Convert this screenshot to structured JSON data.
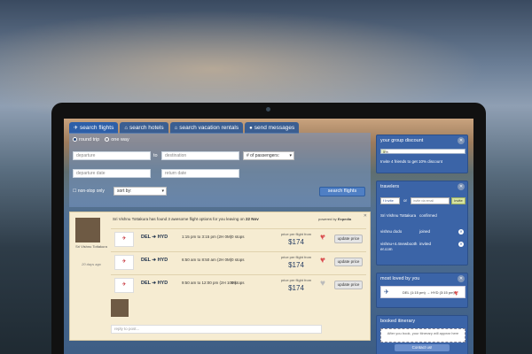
{
  "tabs": [
    {
      "label": "search flights",
      "icon": "plane-icon"
    },
    {
      "label": "search hotels",
      "icon": "home-icon"
    },
    {
      "label": "search vacation rentals",
      "icon": "home-icon"
    },
    {
      "label": "send messages",
      "icon": "chat-icon"
    }
  ],
  "search": {
    "round_trip": "round trip",
    "one_way": "one way",
    "departure_placeholder": "departure",
    "to_label": "to",
    "destination_placeholder": "destination",
    "passengers_label": "# of passengers:",
    "departure_date_placeholder": "departure date",
    "return_date_placeholder": "return date",
    "nonstop_label": "non-stop only",
    "sort_label": "sort by:",
    "search_button": "search flights"
  },
  "results": {
    "user_name": "Sri Vishnu Tottakura",
    "date_note": "20 days ago",
    "headline_prefix": "Sri Vishnu Tottakura has found 3 awesome flight options for you leaving on",
    "headline_date": "22 Nov",
    "powered_by": "powered by",
    "powered_brand": "Expedia",
    "price_label": "price per flight from",
    "update_label": "update price",
    "reply_placeholder": "reply to post...",
    "flights": [
      {
        "from": "DEL",
        "to": "HYD",
        "times": "1:15 pm to 3:15 pm (2H 0M)",
        "stops": "0 stops",
        "price": "$174",
        "likes": "2"
      },
      {
        "from": "DEL",
        "to": "HYD",
        "times": "6:50 am to 8:50 am (2H 0M)",
        "stops": "0 stops",
        "price": "$174",
        "likes": "1"
      },
      {
        "from": "DEL",
        "to": "HYD",
        "times": "9:50 am to 12:00 pm (2H 10M)",
        "stops": "0 stops",
        "price": "$174",
        "likes": ""
      }
    ]
  },
  "group_discount": {
    "title": "your group discount",
    "progress_label": "5%",
    "progress": 0.05,
    "text": "Invite 4 friends to get 10% discount"
  },
  "travelers": {
    "title": "travelers",
    "fb_label": "Invite",
    "or_label": "or",
    "email_placeholder": "invite via email",
    "invite_button": "invite",
    "list": [
      {
        "name": "Sri Vishnu Tottakura",
        "status": "confirmed"
      },
      {
        "name": "vishnu dodo",
        "status": "joined"
      },
      {
        "name": "vishnu+4.4newbooth er.com",
        "status": "invited"
      }
    ]
  },
  "most_loved": {
    "title": "most loved by you",
    "route": "DEL (1:15 pm) → HYD (3:15 pm)",
    "likes": "2"
  },
  "booked": {
    "title": "booked itinerary",
    "text": "After you book, your itinerary will appear here",
    "contact": "Contact us!"
  }
}
